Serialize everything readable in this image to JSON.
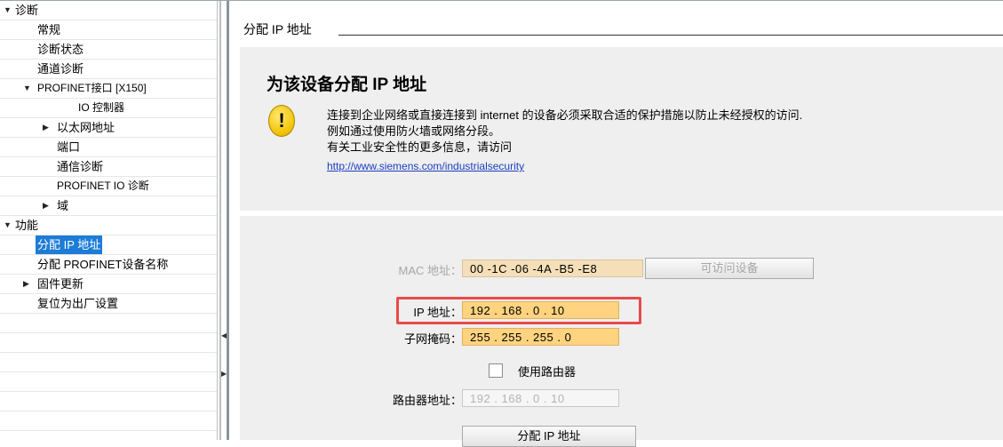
{
  "tree": {
    "items": [
      {
        "label": "诊断",
        "expand": "▼"
      },
      {
        "label": "常规",
        "expand": ""
      },
      {
        "label": "诊断状态",
        "expand": ""
      },
      {
        "label": "通道诊断",
        "expand": ""
      },
      {
        "label": "PROFINET接口 [X150]",
        "expand": "▼"
      },
      {
        "label": "IO 控制器",
        "expand": ""
      },
      {
        "label": "以太网地址",
        "expand": "▶"
      },
      {
        "label": "端口",
        "expand": ""
      },
      {
        "label": "通信诊断",
        "expand": ""
      },
      {
        "label": "PROFINET IO 诊断",
        "expand": ""
      },
      {
        "label": "域",
        "expand": "▶"
      },
      {
        "label": "功能",
        "expand": "▼"
      },
      {
        "label": "分配 IP 地址",
        "expand": ""
      },
      {
        "label": "分配 PROFINET设备名称",
        "expand": ""
      },
      {
        "label": "固件更新",
        "expand": "▶"
      },
      {
        "label": "复位为出厂设置",
        "expand": ""
      }
    ],
    "selected": "分配 IP 地址"
  },
  "splitter": {
    "arrow_left": "◀",
    "arrow_right": "▶"
  },
  "panel": {
    "section_title": "分配 IP 地址",
    "warning": {
      "title": "为该设备分配 IP 地址",
      "icon": "warning-exclamation-icon",
      "line1": "连接到企业网络或直接连接到 internet 的设备必须采取合适的保护措施以防止未经授权的访问.",
      "line2": "例如通过使用防火墙或网络分段。",
      "line3": "有关工业安全性的更多信息，请访问",
      "link": "http://www.siemens.com/industrialsecurity"
    },
    "form": {
      "mac_label": "MAC 地址：",
      "mac_value": "00 -1C -06 -4A -B5 -E8",
      "accessible_devices_button": "可访问设备",
      "ip_label": "IP 地址：",
      "ip_value": "192 . 168 . 0   . 10",
      "subnet_label": "子网掩码：",
      "subnet_value": "255 . 255 . 255 . 0",
      "use_router_label": "使用路由器",
      "use_router_checked": false,
      "router_label": "路由器地址：",
      "router_value": "192 . 168 . 0   . 10",
      "assign_button": "分配 IP 地址"
    }
  },
  "colors": {
    "selection": "#1c7cd6",
    "highlight": "#e84a4a",
    "field_orange": "#ffd380",
    "panel_bg": "#efefef"
  }
}
